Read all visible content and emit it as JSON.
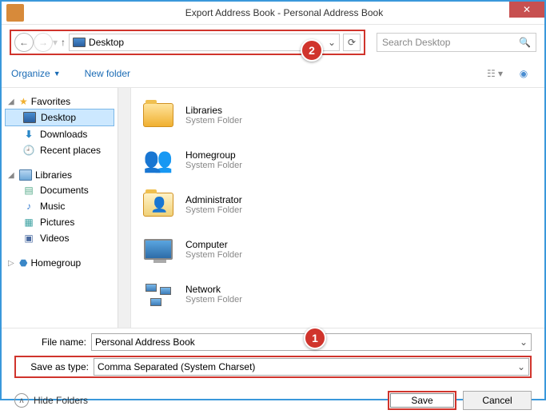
{
  "window": {
    "title": "Export Address Book - Personal Address Book"
  },
  "nav": {
    "location": "Desktop"
  },
  "search": {
    "placeholder": "Search Desktop"
  },
  "toolbar": {
    "organize": "Organize",
    "newfolder": "New folder"
  },
  "sidebar": {
    "favorites": {
      "label": "Favorites",
      "items": [
        {
          "label": "Desktop"
        },
        {
          "label": "Downloads"
        },
        {
          "label": "Recent places"
        }
      ]
    },
    "libraries": {
      "label": "Libraries",
      "items": [
        {
          "label": "Documents"
        },
        {
          "label": "Music"
        },
        {
          "label": "Pictures"
        },
        {
          "label": "Videos"
        }
      ]
    },
    "homegroup": {
      "label": "Homegroup"
    }
  },
  "content": {
    "items": [
      {
        "name": "Libraries",
        "sub": "System Folder",
        "icon": "libraries"
      },
      {
        "name": "Homegroup",
        "sub": "System Folder",
        "icon": "homegroup"
      },
      {
        "name": "Administrator",
        "sub": "System Folder",
        "icon": "user"
      },
      {
        "name": "Computer",
        "sub": "System Folder",
        "icon": "computer"
      },
      {
        "name": "Network",
        "sub": "System Folder",
        "icon": "network"
      }
    ]
  },
  "form": {
    "filename_label": "File name:",
    "filename_value": "Personal Address Book",
    "type_label": "Save as type:",
    "type_value": "Comma Separated (System Charset)"
  },
  "actions": {
    "hide": "Hide Folders",
    "save": "Save",
    "cancel": "Cancel"
  },
  "badges": {
    "one": "1",
    "two": "2"
  }
}
